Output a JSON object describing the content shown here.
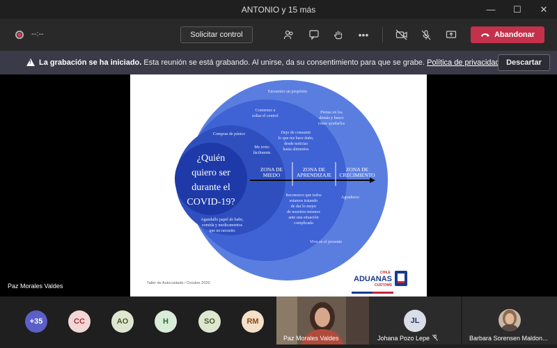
{
  "window": {
    "title": "ANTONIO y 15 más"
  },
  "toolbar": {
    "timer": "--:--",
    "control_label": "Solicitar control",
    "leave_label": "Abandonar"
  },
  "banner": {
    "title": "La grabación se ha iniciado.",
    "message": "Esta reunión se está grabando. Al unirse, da su consentimiento para que se grabe.",
    "link": "Política de privacidad",
    "dismiss": "Descartar"
  },
  "slide": {
    "question_lines": [
      "¿Quién",
      "quiero ser",
      "durante el",
      "COVID-19?"
    ],
    "zones": [
      [
        "ZONA DE",
        "MIEDO"
      ],
      [
        "ZONA DE",
        "APRENDIZAJE"
      ],
      [
        "ZONA DE",
        "CRECIMIENTO"
      ]
    ],
    "notes": {
      "encuentro": "Encuentro un propósito",
      "comienzo": [
        "Comienzo a",
        "soltar el control"
      ],
      "pienso": [
        "Pienso en los",
        "demás y busco",
        "cómo ayudarlos"
      ],
      "compras": "Compras de pánico",
      "dejo": [
        "Dejo de consumir",
        "lo que me hace daño,",
        "desde noticias",
        "hasta alimentos"
      ],
      "irrito": [
        "Me irrito",
        "fácilmente"
      ],
      "reconozco": [
        "Reconozco que todos",
        "estamos tratando",
        "de dar lo mejor",
        "de nosotros mismos",
        "ante una situación",
        "complicada"
      ],
      "agradezco": "Agradezco",
      "acaparo": [
        "Agandallo papel de baño,",
        "comida y medicamentos",
        "que no necesito"
      ],
      "vivo": "Vivo en el presente"
    },
    "footer": "Taller de Autocuidado / Octubre 2020",
    "logo_small": "CHILE",
    "logo_main": "ADUANAS",
    "logo_sub": "CUSTOMS"
  },
  "presenter_name": "Paz Morales Valdes",
  "participants": {
    "overflow": "+35",
    "avatars": [
      {
        "initials": "CC",
        "bg": "#f3d6d6",
        "fg": "#a33"
      },
      {
        "initials": "AO",
        "bg": "#dfe6d0",
        "fg": "#4a5a2a"
      },
      {
        "initials": "H",
        "bg": "#d9ecd9",
        "fg": "#2c6a2c"
      },
      {
        "initials": "SO",
        "bg": "#dfe6d0",
        "fg": "#4a5a2a"
      },
      {
        "initials": "RM",
        "bg": "#f5e0c8",
        "fg": "#8a4a1a"
      }
    ],
    "video_tile_name": "Paz Morales Valdes",
    "tile_jl": {
      "initials": "JL",
      "name": "Johana Pozo Lepe"
    },
    "tile_bs": {
      "name": "Barbara Sorensen Maldon..."
    }
  },
  "colors": {
    "accent_leave": "#c4314b",
    "slide_blue_dark": "#2f4fbf",
    "slide_blue_mid": "#3f62d4",
    "slide_blue_light": "#5a7ee0",
    "overflow_bg": "#5b5fc7"
  }
}
